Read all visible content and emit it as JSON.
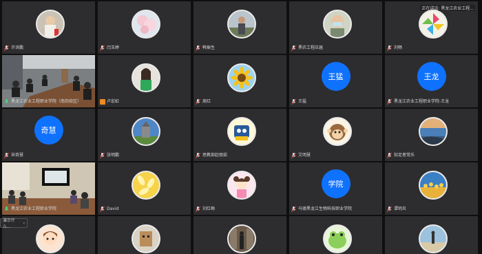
{
  "tiles": [
    {
      "label": "许洪鹏",
      "avatar": "photo-child",
      "kind": "avatar"
    },
    {
      "label": "闫玉婷",
      "avatar": "photo-flowers",
      "kind": "avatar"
    },
    {
      "label": "韩振生",
      "avatar": "photo-man",
      "kind": "avatar"
    },
    {
      "label": "黑农工程应届",
      "avatar": "photo-mask",
      "kind": "avatar"
    },
    {
      "label": "刘畅",
      "avatar": "photo-pinwheel",
      "kind": "avatar",
      "speaking": "正在讲话: 黑龙江农业工程..."
    },
    {
      "label": "黑龙江农业工程职业学院（南岗校区）",
      "kind": "video",
      "scene": "meeting-room"
    },
    {
      "label": "卢宏虹",
      "avatar": "photo-woman",
      "kind": "avatar",
      "hand": true
    },
    {
      "label": "周红",
      "avatar": "photo-sunflower",
      "kind": "avatar"
    },
    {
      "label": "王猛",
      "avatar_text": "王猛",
      "kind": "blue"
    },
    {
      "label": "黑龙江农业工程职业学院-王龙",
      "avatar_text": "王龙",
      "kind": "blue"
    },
    {
      "label": "宋奇慧",
      "avatar_text": "奇慧",
      "kind": "blue"
    },
    {
      "label": "张明鹏",
      "avatar": "photo-castle",
      "kind": "avatar"
    },
    {
      "label": "思教部赵丽茹",
      "avatar": "photo-cartoon",
      "kind": "avatar"
    },
    {
      "label": "艾明慧",
      "avatar": "photo-monkey",
      "kind": "avatar"
    },
    {
      "label": "知足者常乐",
      "avatar": "photo-sea",
      "kind": "avatar"
    },
    {
      "label": "黑龙江农业工程职业学院",
      "kind": "video",
      "scene": "classroom"
    },
    {
      "label": "David",
      "avatar": "photo-yellow",
      "kind": "avatar"
    },
    {
      "label": "刘红梅",
      "avatar": "photo-girl",
      "kind": "avatar"
    },
    {
      "label": "马德黑龙江生物科技职业学院",
      "avatar_text": "学院",
      "kind": "blue"
    },
    {
      "label": "谭玥炎",
      "avatar": "photo-golden",
      "kind": "avatar"
    },
    {
      "label": "",
      "avatar": "photo-cartoon-girl",
      "kind": "avatar"
    },
    {
      "label": "",
      "avatar": "photo-box",
      "kind": "avatar"
    },
    {
      "label": "",
      "avatar": "photo-library",
      "kind": "avatar"
    },
    {
      "label": "",
      "avatar": "photo-frog",
      "kind": "avatar"
    },
    {
      "label": "",
      "avatar": "photo-beach",
      "kind": "avatar"
    }
  ],
  "sidebar_toggle": {
    "label": "演示什么...",
    "icon": "chevron-left-icon"
  },
  "colors": {
    "tile_bg": "#2d2d30",
    "blue_avatar": "#0f72ff",
    "mic_red": "#e0443a"
  }
}
